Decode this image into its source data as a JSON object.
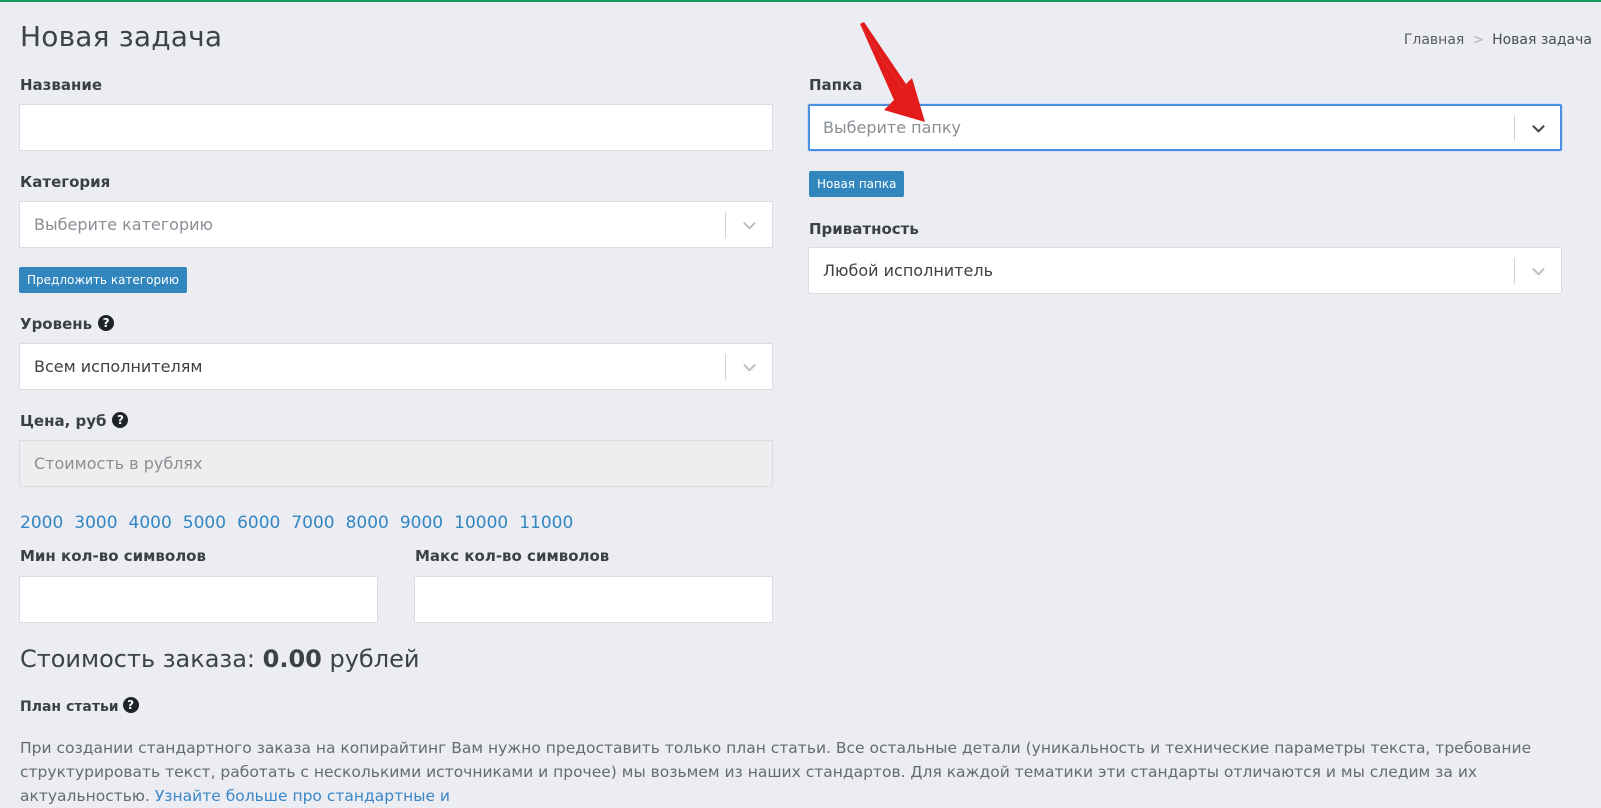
{
  "header": {
    "title": "Новая задача"
  },
  "breadcrumb": {
    "home": "Главная",
    "separator": ">",
    "current": "Новая задача"
  },
  "form": {
    "name_label": "Название",
    "name_value": "",
    "category_label": "Категория",
    "category_placeholder": "Выберите категорию",
    "suggest_category_button": "Предложить категорию",
    "level_label": "Уровень",
    "level_value": "Всем исполнителям",
    "price_label": "Цена, руб",
    "price_placeholder": "Стоимость в рублях",
    "price_presets": [
      "2000",
      "3000",
      "4000",
      "5000",
      "6000",
      "7000",
      "8000",
      "9000",
      "10000",
      "11000"
    ],
    "min_chars_label": "Мин кол-во символов",
    "max_chars_label": "Макс кол-во символов",
    "folder_label": "Папка",
    "folder_placeholder": "Выберите папку",
    "new_folder_button": "Новая папка",
    "privacy_label": "Приватность",
    "privacy_value": "Любой исполнитель"
  },
  "total": {
    "prefix": "Стоимость заказа:",
    "amount": "0.00",
    "suffix": "рублей"
  },
  "plan": {
    "label": "План статьи",
    "text": "При создании стандартного заказа на копирайтинг Вам нужно предоставить только план статьи. Все остальные детали (уникальность и технические параметры текста, требование структурировать текст, работать с несколькими источниками и прочее) мы возьмем из наших стандартов. Для каждой тематики эти стандарты отличаются и мы следим за их актуальностью.",
    "link_text": "Узнайте больше про стандартные и"
  },
  "colors": {
    "accent": "#3187bd",
    "link": "#3286c2",
    "focus": "#4a8fe3",
    "annotation_arrow": "#e31b1b"
  },
  "icons": {
    "help": "question-circle-icon",
    "dropdown": "chevron-down-icon"
  }
}
